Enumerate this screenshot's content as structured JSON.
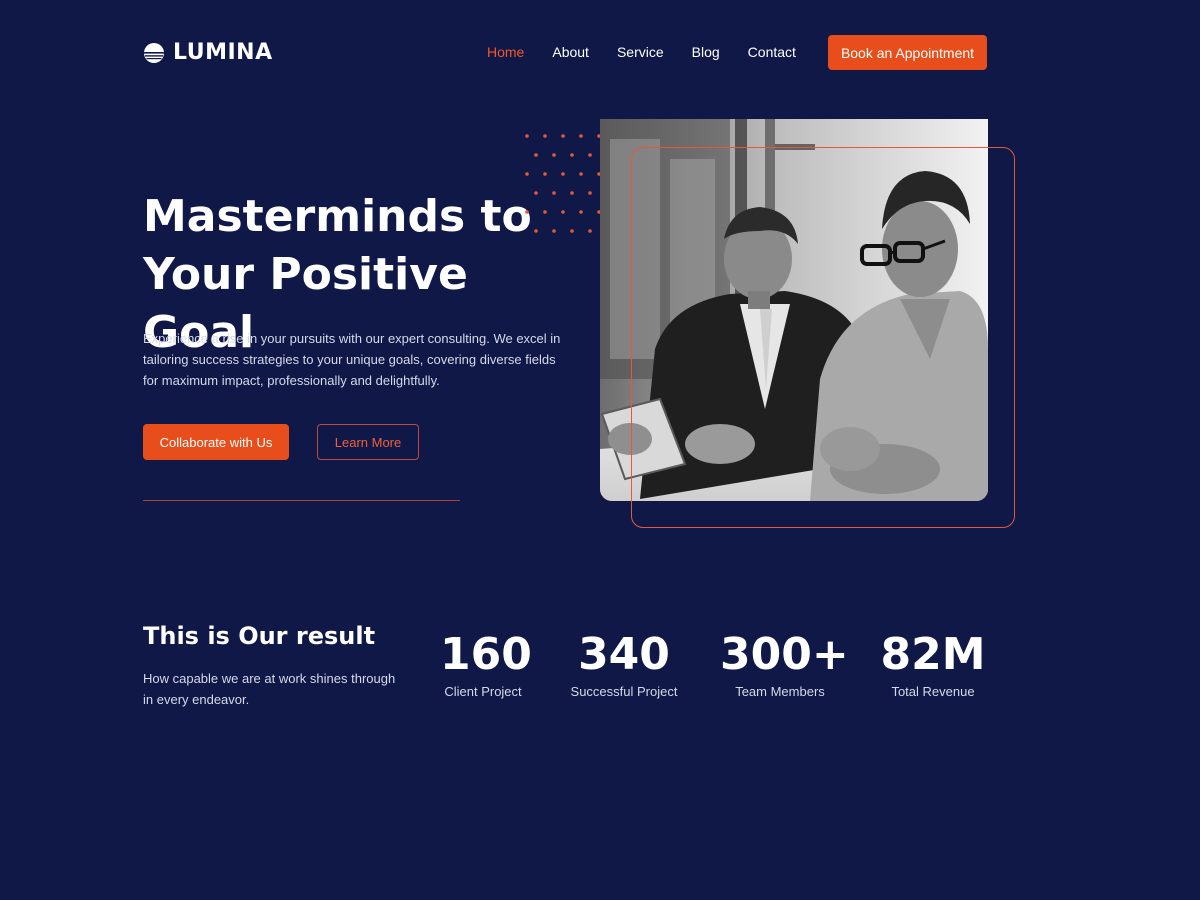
{
  "header": {
    "brand": "LUMINA",
    "nav": [
      {
        "label": "Home",
        "active": true
      },
      {
        "label": "About",
        "active": false
      },
      {
        "label": "Service",
        "active": false
      },
      {
        "label": "Blog",
        "active": false
      },
      {
        "label": "Contact",
        "active": false
      }
    ],
    "cta_label": "Book an Appointment"
  },
  "hero": {
    "title_line1": "Masterminds to",
    "title_line2": "Your Positive Goal",
    "description": "Experience a rise in your pursuits with our expert consulting. We excel in tailoring success strategies to your unique goals, covering diverse fields for maximum impact, professionally and delightfully.",
    "primary_button": "Collaborate with Us",
    "secondary_button": "Learn More",
    "image_icon": "photo-two-businessmen"
  },
  "results": {
    "title": "This is Our result",
    "description": "How capable we are at work shines through in every endeavor.",
    "stats": [
      {
        "value": "160",
        "label": "Client Project"
      },
      {
        "value": "340",
        "label": "Successful Project"
      },
      {
        "value": "300+",
        "label": "Team Members"
      },
      {
        "value": "82M",
        "label": "Total Revenue"
      }
    ]
  },
  "colors": {
    "background": "#0f1847",
    "accent": "#e84e1b",
    "text": "#ffffff",
    "muted_text": "#d6d9e8"
  }
}
